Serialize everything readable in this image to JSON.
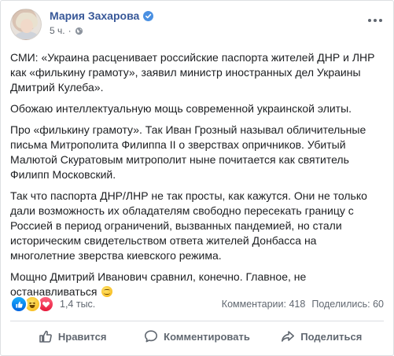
{
  "post": {
    "author": "Мария Захарова",
    "time": "5 ч.",
    "separator": "·",
    "paragraphs": [
      "СМИ: «Украина расценивает российские паспорта жителей ДНР и ЛНР как «филькину грамоту», заявил министр иностранных дел Украины Дмитрий Кулеба».",
      "Обожаю интеллектуальную мощь современной украинской элиты.",
      "Про «филькину грамоту». Так Иван Грозный называл обличительные письма Митрополита Филиппа II о зверствах опричников. Убитый Малютой Скуратовым митрополит ныне почитается как святитель Филипп Московский.",
      "Так что паспорта ДНР/ЛНР не так просты, как кажутся. Они не только дали возможность их обладателям свободно пересекать границу с Россией в период ограничений, вызванных пандемией, но стали историческим свидетельством ответа жителей Донбасса на многолетние зверства киевского режима.",
      "Мощно Дмитрий Иванович сравнил, конечно. Главное, не останавливаться"
    ],
    "reactions_count": "1,4 тыс.",
    "comments": "Комментарии: 418",
    "shares": "Поделились: 60"
  },
  "actions": {
    "like": "Нравится",
    "comment": "Комментировать",
    "share": "Поделиться"
  },
  "icons": {
    "verified": "verified-badge-icon",
    "privacy": "globe-icon",
    "more": "more-options-icon",
    "reaction_like": "like-reaction-icon",
    "reaction_haha": "haha-reaction-icon",
    "reaction_love": "love-reaction-icon",
    "emoji": "smile-emoji-icon"
  },
  "colors": {
    "author_link": "#385898",
    "secondary_text": "#606770",
    "verified": "#4a90e2",
    "like": "#1877f2",
    "love": "#e61739"
  }
}
